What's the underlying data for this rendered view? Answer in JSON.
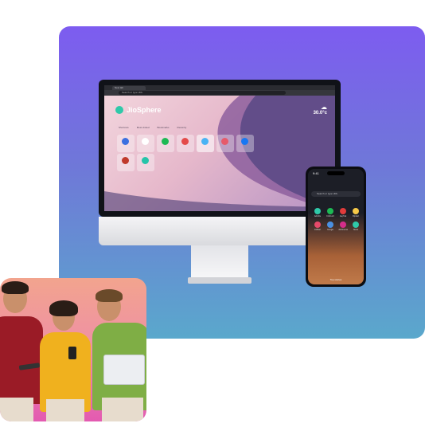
{
  "desktop": {
    "tab_title": "New tab",
    "url_placeholder": "Search or type URL",
    "logo_text": "JioSphere",
    "weather": {
      "temp": "30.0°c",
      "icon": "cloud-icon"
    },
    "categories": [
      "Shortcuts",
      "Most visited",
      "Bookmarks",
      "Recently"
    ],
    "tiles": [
      {
        "label": "",
        "color": "#3b6fe0",
        "icon": "search-icon"
      },
      {
        "label": "",
        "color": "#ffffff",
        "icon": "play-icon"
      },
      {
        "label": "",
        "color": "#1db954",
        "icon": "music-icon"
      },
      {
        "label": "",
        "color": "#e44a4a",
        "icon": "app-icon"
      },
      {
        "label": "",
        "color": "#4ab3f4",
        "icon": "app-icon",
        "selected": true
      },
      {
        "label": "",
        "color": "#e65a6a",
        "icon": "app-icon"
      },
      {
        "label": "",
        "color": "#1877f2",
        "icon": "facebook-icon"
      },
      {
        "label": "",
        "color": "#c0392b",
        "icon": "app-icon"
      },
      {
        "label": "",
        "color": "#25c4a9",
        "icon": "app-icon"
      }
    ]
  },
  "phone": {
    "time": "9:41",
    "search_placeholder": "Search or type URL",
    "bottom_text": "Top stories",
    "apps": [
      {
        "label": "Add tile",
        "color": "#2fc9a9"
      },
      {
        "label": "Cricbuzz",
        "color": "#1db954"
      },
      {
        "label": "Aaj Tak",
        "color": "#e13b3b"
      },
      {
        "label": "Flipkart",
        "color": "#f7c948"
      },
      {
        "label": "JioMart",
        "color": "#e74a6a"
      },
      {
        "label": "Google",
        "color": "#4a90e2"
      },
      {
        "label": "JioCinema",
        "color": "#d42d8a"
      },
      {
        "label": "News",
        "color": "#2fc9a9"
      }
    ]
  }
}
